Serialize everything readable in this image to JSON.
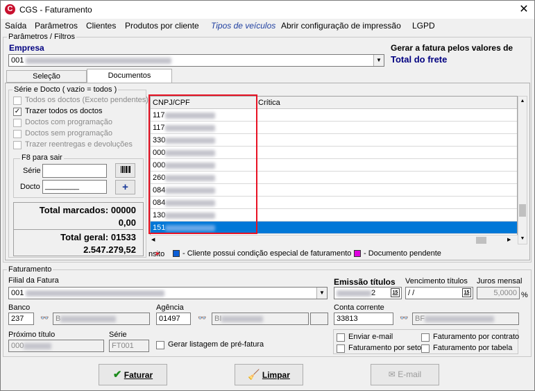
{
  "window": {
    "title": "CGS - Faturamento",
    "app_icon": "C",
    "close_glyph": "✕"
  },
  "menu": {
    "saida": "Saída",
    "parametros": "Parâmetros",
    "clientes": "Clientes",
    "produtos": "Produtos por cliente",
    "tipos": "Tipos de veículos",
    "abrir": "Abrir configuração de impressão",
    "lgpd": "LGPD"
  },
  "params": {
    "group_title": "Parâmetros / Filtros",
    "empresa_label": "Empresa",
    "empresa_value": "001",
    "gerar_label": "Gerar a fatura pelos valores de",
    "gerar_value": "Total do frete"
  },
  "tabs": {
    "selecao": "Seleção",
    "documentos": "Documentos"
  },
  "serie_docto": {
    "group_title": "Série e Docto  ( vazio = todos )",
    "options": [
      {
        "label": "Todos os doctos (Exceto pendentes)",
        "checked": false,
        "enabled": false
      },
      {
        "label": "Trazer todos os doctos",
        "checked": true,
        "enabled": true
      },
      {
        "label": "Doctos com programação",
        "checked": false,
        "enabled": false
      },
      {
        "label": "Doctos sem programação",
        "checked": false,
        "enabled": false
      },
      {
        "label": "Trazer reentregas e devoluções",
        "checked": false,
        "enabled": false
      }
    ],
    "f8_title": "F8 para sair",
    "serie_label": "Série",
    "docto_label": "Docto",
    "docto_mask": "________",
    "add_glyph": "+"
  },
  "totals": {
    "marcados_label": "Total marcados: 00000",
    "marcados_value": "0,00",
    "geral_label": "Total geral: 01533",
    "geral_value": "2.547.279,52"
  },
  "grid": {
    "col_cnpj": "CNPJ/CPF",
    "col_critica": "Crítica",
    "rows": [
      "117",
      "117",
      "330",
      "000",
      "000",
      "260",
      "084",
      "084",
      "130",
      "151"
    ],
    "selected_row": 9
  },
  "legend": {
    "prefix": "nsito",
    "item1": "- Cliente possui condição especial de faturamento",
    "item1_color": "#0b5ed7",
    "item2": "- Documento pendente",
    "item2_color": "#e000e0"
  },
  "faturamento": {
    "group_title": "Faturamento",
    "filial_label": "Filial da Fatura",
    "filial_value": "001",
    "emissao_label": "Emissão títulos",
    "emissao_value": "2",
    "vencimento_label": "Vencimento títulos",
    "vencimento_value": " / /",
    "juros_label": "Juros mensal",
    "juros_value": "5,0000",
    "juros_unit": "%",
    "banco_label": "Banco",
    "banco_code": "237",
    "banco_name": "B",
    "agencia_label": "Agência",
    "agencia_code": "01497",
    "agencia_name": "BI",
    "conta_label": "Conta corrente",
    "conta_value": "33813",
    "conta_name": "BF",
    "proximo_label": "Próximo título",
    "proximo_value": "000",
    "serie_label": "Série",
    "serie_value": "FT001",
    "gerar_listagem": "Gerar listagem de pré-fatura",
    "enviar_email": "Enviar e-mail",
    "fat_contrato": "Faturamento por contrato",
    "fat_setor": "Faturamento por setor",
    "fat_tabela": "Faturamento por tabela",
    "cal_glyph": "15"
  },
  "buttons": {
    "faturar": "Faturar",
    "limpar": "Limpar",
    "email": "E-mail"
  },
  "colors": {
    "accent": "#0078d7",
    "highlight_border": "#e81123",
    "title_blue": "#000080"
  }
}
